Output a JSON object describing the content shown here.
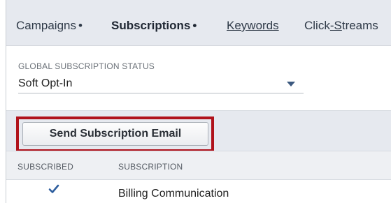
{
  "tabs": [
    {
      "label": "Campaigns",
      "suffix": "•",
      "active": false
    },
    {
      "label": "Subscriptions",
      "suffix": "•",
      "active": true
    },
    {
      "label": "Keywords",
      "suffix": "",
      "active": false
    },
    {
      "label": "Click-Streams",
      "suffix": "",
      "active": false
    }
  ],
  "global_status": {
    "label": "GLOBAL SUBSCRIPTION STATUS",
    "value": "Soft Opt-In"
  },
  "actions": {
    "send_subscription_email": "Send Subscription Email"
  },
  "table": {
    "columns": [
      "SUBSCRIBED",
      "SUBSCRIPTION"
    ],
    "rows": [
      {
        "subscribed": true,
        "subscription": "Billing Communication"
      }
    ]
  },
  "colors": {
    "highlight": "#b0121b",
    "checkmark": "#2e5e9e"
  }
}
